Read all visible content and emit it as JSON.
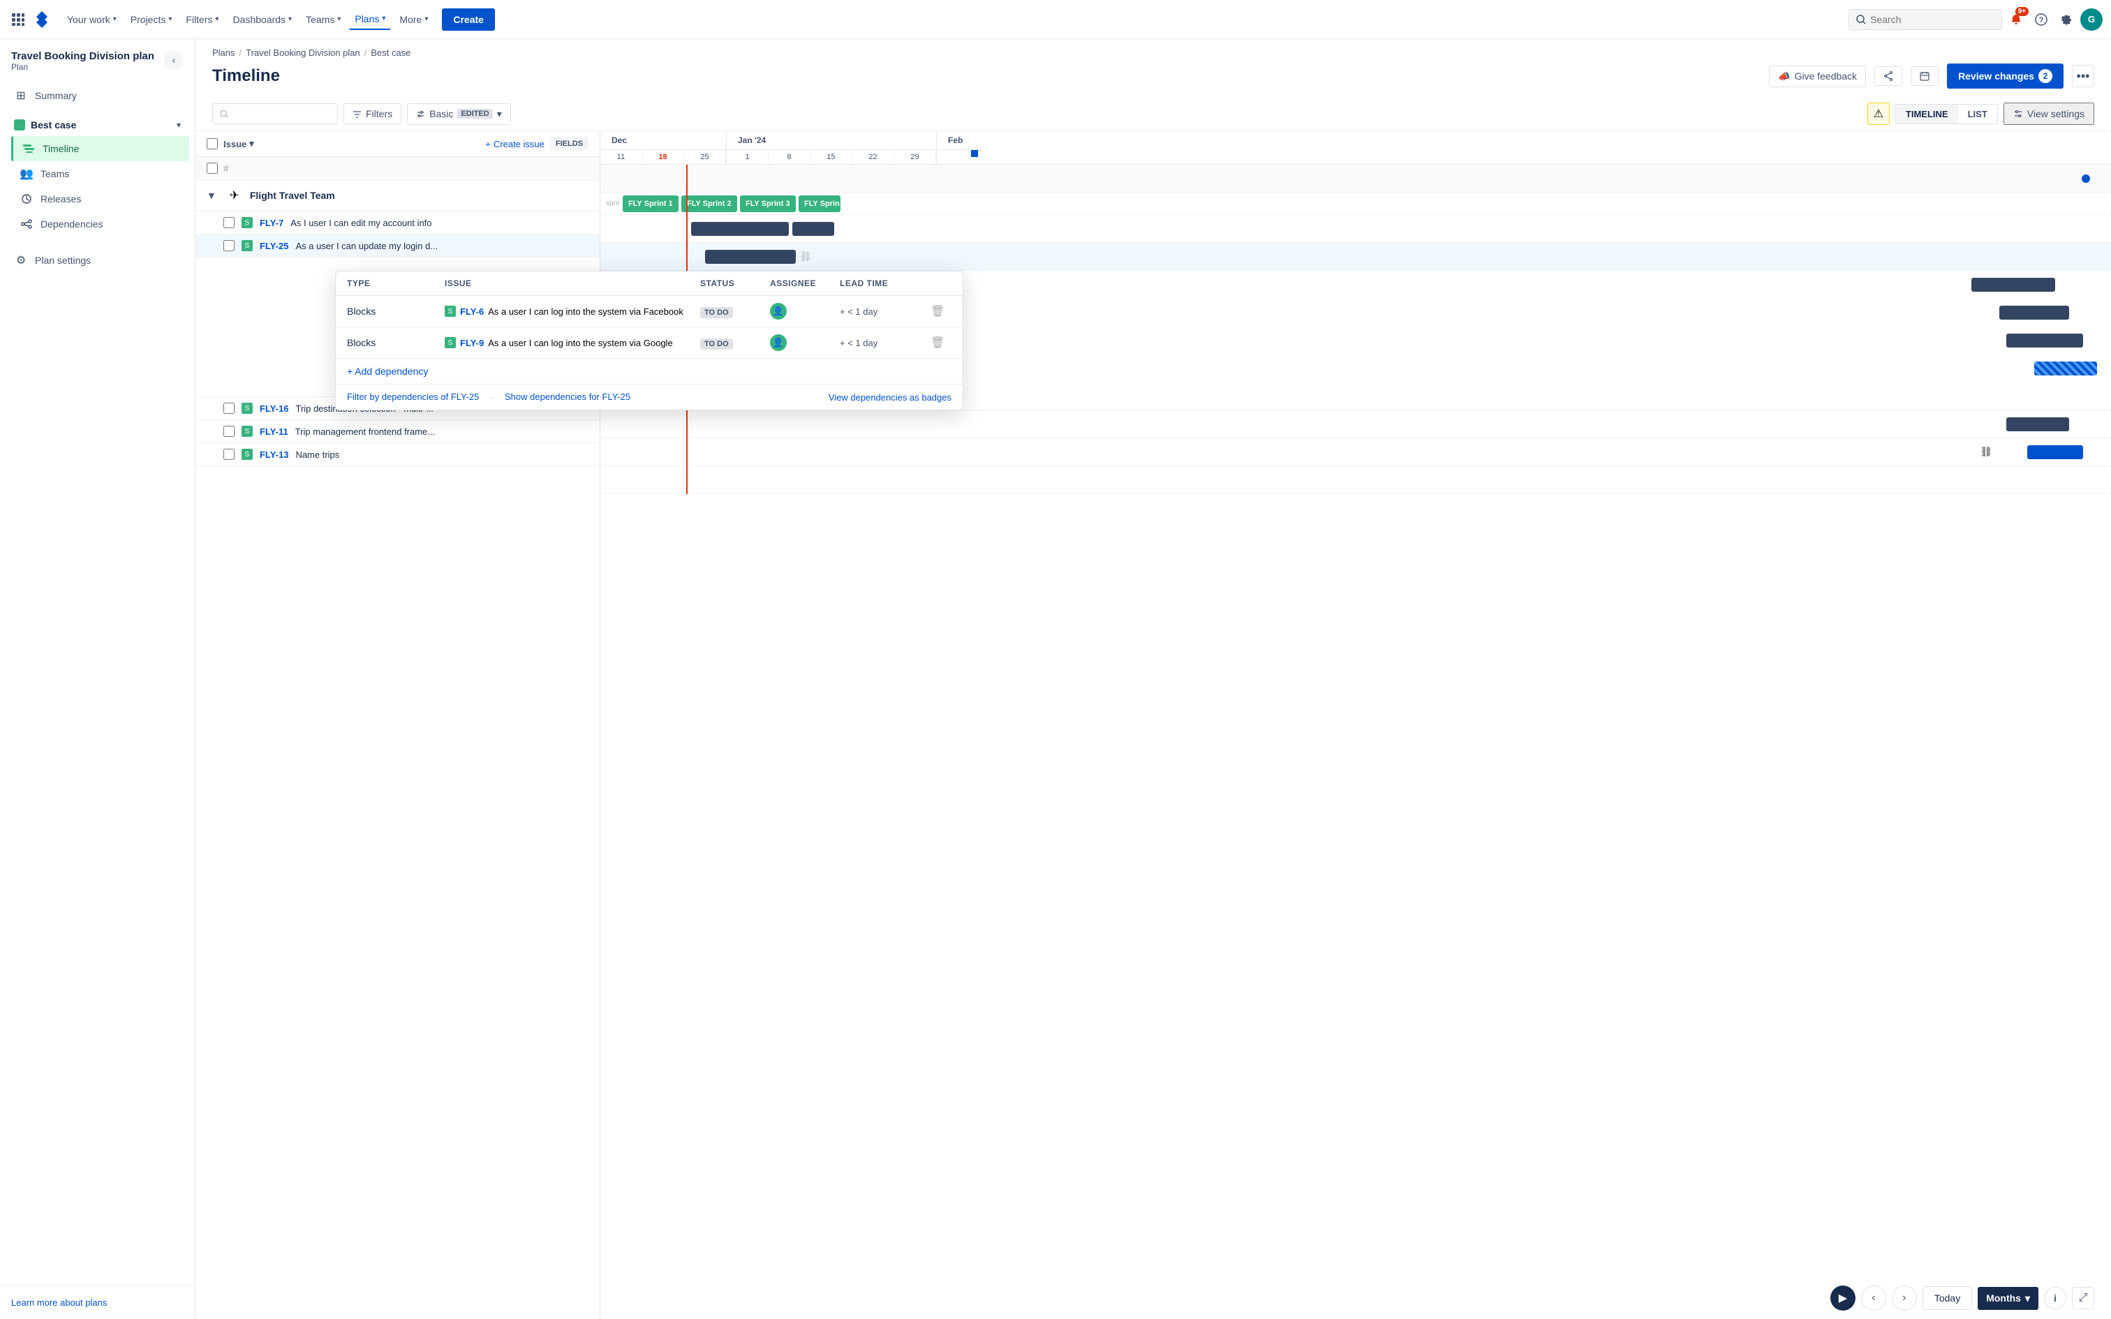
{
  "app": {
    "title": "Jira"
  },
  "topnav": {
    "logo_text": "J",
    "items": [
      {
        "label": "Your work",
        "has_chevron": true
      },
      {
        "label": "Projects",
        "has_chevron": true
      },
      {
        "label": "Filters",
        "has_chevron": true
      },
      {
        "label": "Dashboards",
        "has_chevron": true
      },
      {
        "label": "Teams",
        "has_chevron": true
      },
      {
        "label": "Plans",
        "has_chevron": true,
        "active": true
      },
      {
        "label": "More",
        "has_chevron": true
      }
    ],
    "create_label": "Create",
    "search_placeholder": "Search",
    "notification_count": "9+",
    "avatar_initials": "G"
  },
  "sidebar": {
    "project_name": "Travel Booking Division plan",
    "project_subtitle": "Plan",
    "nav_items": [
      {
        "label": "Summary",
        "icon": "grid"
      }
    ],
    "best_case_label": "Best case",
    "best_case_items": [
      {
        "label": "Timeline",
        "active": true
      },
      {
        "label": "Teams"
      },
      {
        "label": "Releases"
      },
      {
        "label": "Dependencies"
      }
    ],
    "plan_settings_label": "Plan settings",
    "learn_more_label": "Learn more about plans"
  },
  "breadcrumb": {
    "items": [
      "Plans",
      "Travel Booking Division plan",
      "Best case"
    ]
  },
  "page_header": {
    "title": "Timeline",
    "feedback_label": "Give feedback",
    "review_label": "Review changes",
    "review_count": "2"
  },
  "toolbar": {
    "filter_label": "Filters",
    "basic_label": "Basic",
    "edited_label": "EDITED",
    "timeline_label": "TIMELINE",
    "list_label": "LIST",
    "view_settings_label": "View settings"
  },
  "issue_list": {
    "column_label": "Issue",
    "create_label": "Create issue",
    "fields_label": "FIELDS",
    "hash_label": "#",
    "team_name": "Flight Travel Team",
    "issues": [
      {
        "key": "FLY-7",
        "title": "As I user I can edit my account info"
      },
      {
        "key": "FLY-25",
        "title": "As a user I can update my login d..."
      },
      {
        "key": "FLY-16",
        "title": "Trip destination selection - multi-..."
      },
      {
        "key": "FLY-11",
        "title": "Trip management frontend frame..."
      },
      {
        "key": "FLY-13",
        "title": "Name trips"
      }
    ]
  },
  "timeline": {
    "months": [
      {
        "label": "Dec",
        "weeks": [
          "11",
          "18",
          "25"
        ]
      },
      {
        "label": "Jan '24",
        "weeks": [
          "1",
          "8",
          "15",
          "22",
          "29"
        ]
      },
      {
        "label": "Feb"
      }
    ],
    "sprints": [
      {
        "label": "FLY Sprint 1",
        "color": "green"
      },
      {
        "label": "FLY Sprint 2",
        "color": "green"
      },
      {
        "label": "FLY Sprint 3",
        "color": "green"
      },
      {
        "label": "FLY Sprint...",
        "color": "green"
      }
    ]
  },
  "dependency_panel": {
    "columns": [
      "Type",
      "Issue",
      "Status",
      "Assignee",
      "Lead time"
    ],
    "rows": [
      {
        "type": "Blocks",
        "issue_key": "FLY-6",
        "issue_title": "As a user I can log into the system via Facebook",
        "status": "TO DO",
        "lead_time": "+ < 1 day"
      },
      {
        "type": "Blocks",
        "issue_key": "FLY-9",
        "issue_title": "As a user I can log into the system via Google",
        "status": "TO DO",
        "lead_time": "+ < 1 day"
      }
    ],
    "add_label": "+ Add dependency",
    "filter_link": "Filter by dependencies of FLY-25",
    "show_link": "Show dependencies for FLY-25",
    "view_badges_link": "View dependencies as badges"
  },
  "bottom_bar": {
    "prev_icon": "‹",
    "next_icon": "›",
    "today_label": "Today",
    "months_label": "Months",
    "info_icon": "i",
    "expand_icon": "⤢"
  }
}
